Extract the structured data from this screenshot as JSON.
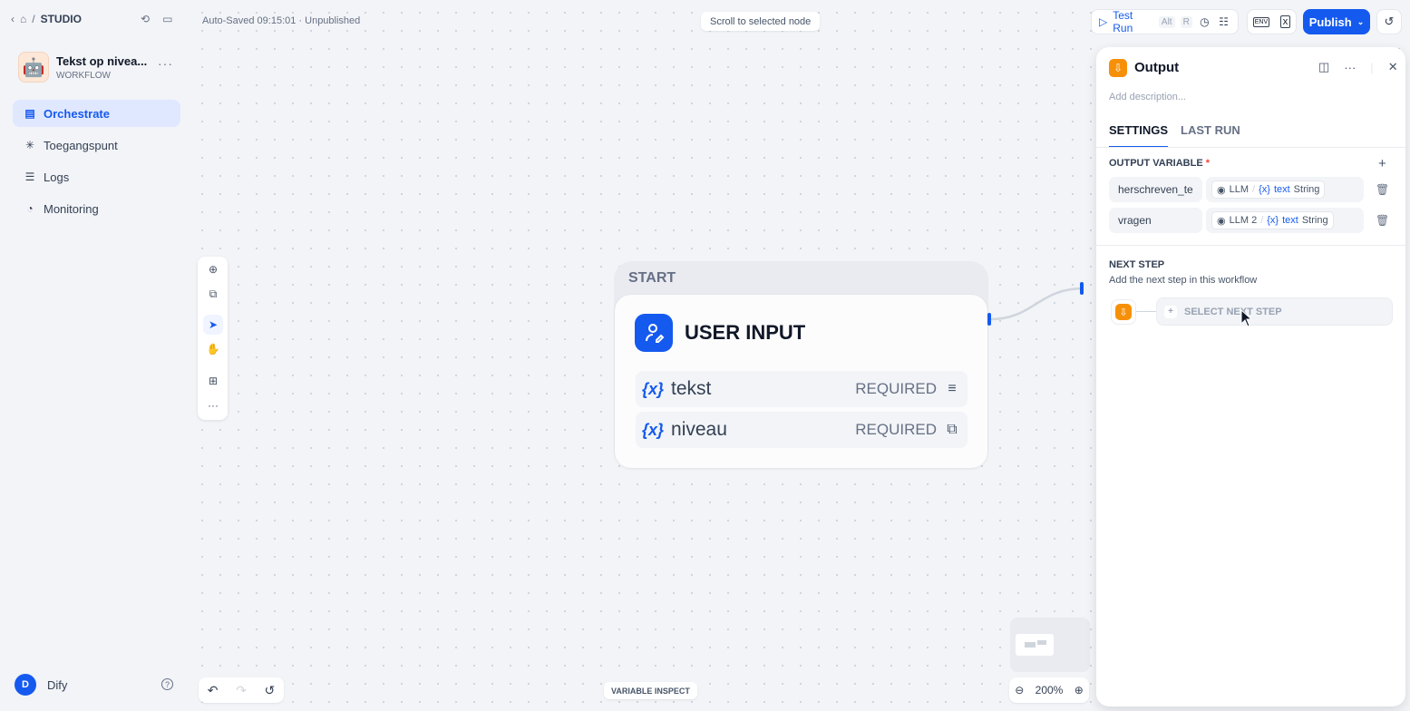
{
  "breadcrumb": {
    "section": "STUDIO"
  },
  "app": {
    "name": "Tekst op nivea...",
    "type": "WORKFLOW",
    "emoji": "🤖"
  },
  "nav": [
    {
      "label": "Orchestrate",
      "icon": "orchestrate-icon",
      "active": true
    },
    {
      "label": "Toegangspunt",
      "icon": "access-point-icon"
    },
    {
      "label": "Logs",
      "icon": "logs-icon"
    },
    {
      "label": "Monitoring",
      "icon": "monitoring-icon"
    }
  ],
  "user": {
    "initial": "D",
    "name": "Dify"
  },
  "status": {
    "autosave": "Auto-Saved 09:15:01 · Unpublished"
  },
  "canvas": {
    "scroll_hint": "Scroll to selected node",
    "zoom": "200%",
    "variable_inspect": "VARIABLE INSPECT"
  },
  "toolbar": {
    "test_run_label": "Test Run",
    "test_run_shortcut_1": "Alt",
    "test_run_shortcut_2": "R",
    "env_label": "ENV",
    "publish_label": "Publish"
  },
  "start_node": {
    "header": "START",
    "title": "USER INPUT",
    "variables": [
      {
        "name": "tekst",
        "required": "REQUIRED",
        "type_icon": "paragraph-icon"
      },
      {
        "name": "niveau",
        "required": "REQUIRED",
        "type_icon": "select-icon"
      }
    ]
  },
  "panel": {
    "title": "Output",
    "description_placeholder": "Add description...",
    "tabs": [
      {
        "label": "SETTINGS",
        "active": true
      },
      {
        "label": "LAST RUN"
      }
    ],
    "output_variable_label": "OUTPUT VARIABLE",
    "required_mark": "*",
    "outputs": [
      {
        "name": "herschreven_te",
        "node": "LLM",
        "var": "text",
        "type": "String"
      },
      {
        "name": "vragen",
        "node": "LLM 2",
        "var": "text",
        "type": "String"
      }
    ],
    "next_step_label": "NEXT STEP",
    "next_step_desc": "Add the next step in this workflow",
    "select_next_step": "SELECT NEXT STEP"
  },
  "colors": {
    "accent": "#155aef",
    "output_node": "#f79009"
  }
}
